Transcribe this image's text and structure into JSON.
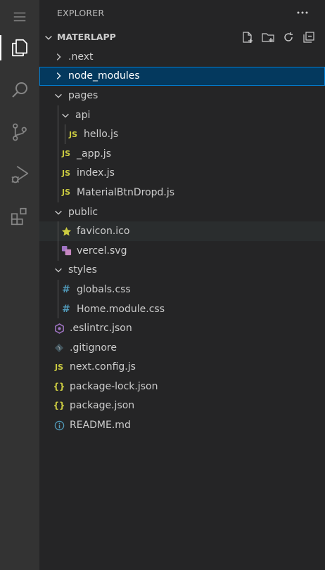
{
  "explorer": {
    "title": "EXPLORER",
    "workspace": "MATERLAPP"
  },
  "activity_bar": {
    "items": [
      {
        "icon": "explorer-icon",
        "active": true
      },
      {
        "icon": "search-icon"
      },
      {
        "icon": "source-control-icon"
      },
      {
        "icon": "run-debug-icon"
      },
      {
        "icon": "extensions-icon"
      }
    ]
  },
  "workspace_actions": [
    "new-file-icon",
    "new-folder-icon",
    "refresh-icon",
    "collapse-all-icon"
  ],
  "tree": [
    {
      "label": ".next",
      "type": "folder",
      "expanded": false
    },
    {
      "label": "node_modules",
      "type": "folder",
      "expanded": false,
      "selected": true
    },
    {
      "label": "pages",
      "type": "folder",
      "expanded": true
    },
    {
      "label": "api",
      "type": "folder",
      "expanded": true
    },
    {
      "label": "hello.js",
      "type": "js"
    },
    {
      "label": "_app.js",
      "type": "js"
    },
    {
      "label": "index.js",
      "type": "js"
    },
    {
      "label": "MaterialBtnDropd.js",
      "type": "js"
    },
    {
      "label": "public",
      "type": "folder",
      "expanded": true
    },
    {
      "label": "favicon.ico",
      "type": "favicon"
    },
    {
      "label": "vercel.svg",
      "type": "svg"
    },
    {
      "label": "styles",
      "type": "folder",
      "expanded": true
    },
    {
      "label": "globals.css",
      "type": "css"
    },
    {
      "label": "Home.module.css",
      "type": "css"
    },
    {
      "label": ".eslintrc.json",
      "type": "eslint"
    },
    {
      "label": ".gitignore",
      "type": "git"
    },
    {
      "label": "next.config.js",
      "type": "js"
    },
    {
      "label": "package-lock.json",
      "type": "json"
    },
    {
      "label": "package.json",
      "type": "json"
    },
    {
      "label": "README.md",
      "type": "info"
    }
  ],
  "colors": {
    "activity_bar": "#333333",
    "sidebar": "#252526",
    "selection": "#04395e",
    "selection_border": "#007fd4",
    "js": "#cbcb41",
    "css": "#519aba"
  }
}
